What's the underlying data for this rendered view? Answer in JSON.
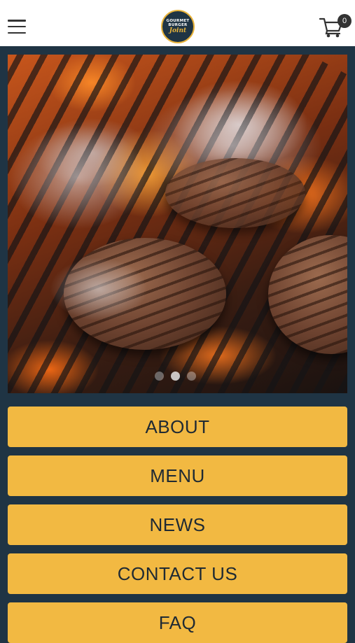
{
  "header": {
    "logo_text": [
      "GOURMET",
      "BURGER",
      "Joint"
    ],
    "cart_count": "0"
  },
  "hero": {
    "slide_count": 3,
    "active_slide": 2
  },
  "nav": {
    "items": [
      {
        "label": "ABOUT"
      },
      {
        "label": "MENU"
      },
      {
        "label": "NEWS"
      },
      {
        "label": "CONTACT US"
      },
      {
        "label": "FAQ"
      }
    ]
  },
  "colors": {
    "background": "#1f3444",
    "button": "#f2b942",
    "button_text": "#1f2a33",
    "header": "#ffffff"
  }
}
